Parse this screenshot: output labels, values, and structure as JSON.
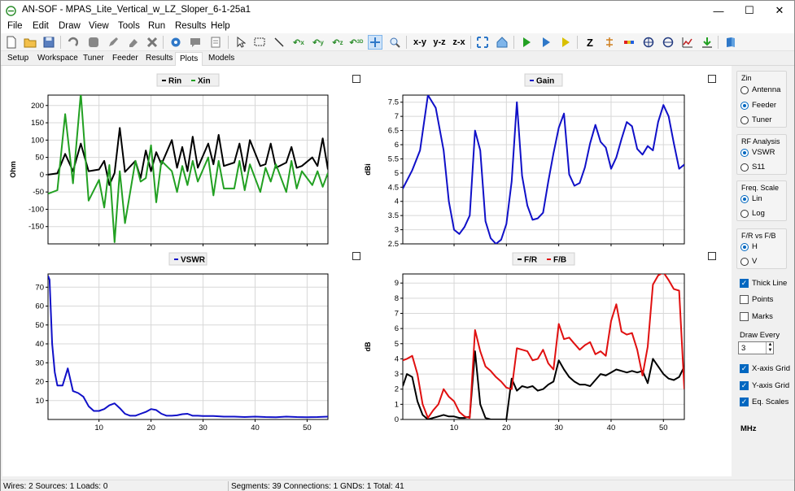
{
  "window": {
    "title": "AN-SOF - MPAS_Lite_Vertical_w_LZ_Sloper_6-1-25a1",
    "minimize": "—",
    "maximize": "☐",
    "close": "✕"
  },
  "menu": [
    "File",
    "Edit",
    "Draw",
    "View",
    "Tools",
    "Run",
    "Results",
    "Help"
  ],
  "toolbar": {
    "projection_labels": [
      "x-y",
      "y-z",
      "z-x"
    ],
    "zin_label": "Z",
    "icons": [
      "new-file-icon",
      "open-folder-icon",
      "save-icon",
      "undo-icon",
      "stop-icon",
      "pencil-icon",
      "eraser-icon",
      "delete-icon",
      "settings-gear-icon",
      "comment-icon",
      "notes-icon",
      "pointer-icon",
      "select-rect-icon",
      "line-icon",
      "rotate-x-icon",
      "rotate-y-icon",
      "rotate-z-icon",
      "rotate-3d-icon",
      "pan-icon",
      "zoom-icon",
      "fit-icon",
      "home-icon",
      "run-icon",
      "run-step-icon",
      "run-all-icon",
      "zin-icon",
      "current-distribution-icon",
      "near-field-icon",
      "far-field-3d-icon",
      "far-field-2d-icon",
      "chart-icon",
      "export-icon",
      "help-book-icon"
    ]
  },
  "tabs": [
    "Setup",
    "Workspace",
    "Tuner",
    "Feeder",
    "Results",
    "Plots",
    "Models"
  ],
  "active_tab": "Plots",
  "colors": {
    "black_series": "#000000",
    "green_series": "#22a022",
    "blue_series": "#1010c8",
    "red_series": "#e01010",
    "accent": "#0067c0"
  },
  "sidebar": {
    "zin": {
      "title": "Zin",
      "options": [
        "Antenna",
        "Feeder",
        "Tuner"
      ],
      "selected": "Feeder"
    },
    "rf": {
      "title": "RF Analysis",
      "options": [
        "VSWR",
        "S11"
      ],
      "selected": "VSWR"
    },
    "freq": {
      "title": "Freq. Scale",
      "options": [
        "Lin",
        "Log"
      ],
      "selected": "Lin"
    },
    "fr": {
      "title": "F/R vs F/B",
      "options": [
        "H",
        "V"
      ],
      "selected": "H"
    },
    "checks": [
      {
        "label": "Thick Line",
        "checked": true
      },
      {
        "label": "Points",
        "checked": false
      },
      {
        "label": "Marks",
        "checked": false
      }
    ],
    "draw_every_label": "Draw Every",
    "draw_every_value": "3",
    "checks2": [
      {
        "label": "X-axis Grid",
        "checked": true
      },
      {
        "label": "Y-axis Grid",
        "checked": true
      },
      {
        "label": "Eq. Scales",
        "checked": true
      }
    ],
    "unit": "MHz"
  },
  "status": {
    "left": "Wires: 2  Sources: 1  Loads: 0",
    "right": "Segments: 39  Connections: 1  GNDs: 1  Total: 41"
  },
  "chart_data": [
    {
      "type": "line",
      "ylabel": "Ohm",
      "xlim": [
        0.2,
        54
      ],
      "ylim": [
        -200,
        230
      ],
      "yticks": [
        -150,
        -100,
        -50,
        0,
        50,
        100,
        150,
        200
      ],
      "xticks": [
        10,
        20,
        30,
        40,
        50
      ],
      "show_x_ticklabels": false,
      "grid": true,
      "legend": "top-center",
      "x": [
        0.2,
        2,
        3.5,
        5,
        6.5,
        8,
        10,
        11,
        12,
        13,
        14,
        15,
        17,
        18,
        19,
        20,
        21,
        22,
        24,
        25,
        26,
        27,
        28,
        29,
        31,
        32,
        33,
        34,
        36,
        37,
        38,
        39,
        41,
        42,
        43,
        44,
        46,
        47,
        48,
        49,
        51,
        52,
        53,
        54
      ],
      "series": [
        {
          "name": "Rin",
          "color": "#000000",
          "values": [
            0,
            4,
            60,
            10,
            90,
            10,
            15,
            40,
            -30,
            5,
            135,
            8,
            40,
            -10,
            70,
            10,
            65,
            30,
            100,
            20,
            80,
            10,
            110,
            20,
            90,
            30,
            115,
            25,
            35,
            90,
            10,
            100,
            25,
            30,
            90,
            20,
            35,
            80,
            20,
            25,
            50,
            25,
            105,
            15
          ]
        },
        {
          "name": "Xin",
          "color": "#22a022",
          "values": [
            -55,
            -45,
            175,
            -25,
            235,
            -75,
            -15,
            -95,
            28,
            -195,
            10,
            -140,
            40,
            -20,
            -10,
            85,
            -80,
            40,
            10,
            -50,
            25,
            -30,
            40,
            -20,
            50,
            -60,
            40,
            -40,
            -40,
            40,
            -45,
            30,
            -50,
            20,
            -20,
            30,
            -50,
            40,
            -40,
            10,
            -30,
            10,
            -35,
            5
          ]
        }
      ]
    },
    {
      "type": "line",
      "ylabel": "dBi",
      "xlim": [
        0.2,
        54
      ],
      "ylim": [
        2.5,
        7.75
      ],
      "yticks": [
        2.5,
        3,
        3.5,
        4,
        4.5,
        5,
        5.5,
        6,
        6.5,
        7,
        7.5
      ],
      "xticks": [
        10,
        20,
        30,
        40,
        50
      ],
      "show_x_ticklabels": false,
      "grid": true,
      "legend": "top-center",
      "x": [
        0.2,
        2,
        3.5,
        5,
        6.5,
        8,
        9,
        10,
        11,
        12,
        13,
        14,
        15,
        16,
        17,
        18,
        19,
        20,
        21,
        22,
        23,
        24,
        25,
        26,
        27,
        28,
        29,
        30,
        31,
        32,
        33,
        34,
        35,
        36,
        37,
        38,
        39,
        40,
        41,
        42,
        43,
        44,
        45,
        46,
        47,
        48,
        49,
        50,
        51,
        52,
        53,
        54
      ],
      "series": [
        {
          "name": "Gain",
          "color": "#1010c8",
          "values": [
            4.45,
            5.1,
            5.8,
            7.75,
            7.3,
            5.8,
            4,
            3,
            2.85,
            3.1,
            3.5,
            6.5,
            5.8,
            3.3,
            2.7,
            2.5,
            2.65,
            3.2,
            4.7,
            7.5,
            4.9,
            3.85,
            3.35,
            3.4,
            3.6,
            4.7,
            5.7,
            6.6,
            7.1,
            4.95,
            4.55,
            4.65,
            5.2,
            6.05,
            6.7,
            6.1,
            5.9,
            5.15,
            5.55,
            6.2,
            6.8,
            6.65,
            5.85,
            5.65,
            5.95,
            5.8,
            6.8,
            7.4,
            7,
            6.05,
            5.15,
            5.3,
            6.35,
            7
          ]
        }
      ]
    },
    {
      "type": "line",
      "ylabel": "",
      "xlim": [
        0.2,
        54
      ],
      "ylim": [
        0,
        77
      ],
      "yticks": [
        10,
        20,
        30,
        40,
        50,
        60,
        70
      ],
      "xticks": [
        10,
        20,
        30,
        40,
        50
      ],
      "show_x_ticklabels": true,
      "grid": true,
      "legend": "top-center",
      "x": [
        0.2,
        0.5,
        1,
        1.5,
        2,
        3,
        4,
        5,
        6,
        7,
        8,
        9,
        10,
        11,
        12,
        13,
        14,
        15,
        16,
        17,
        18,
        19,
        20,
        21,
        22,
        23,
        24,
        25,
        26,
        27,
        28,
        29,
        30,
        32,
        34,
        36,
        38,
        40,
        42,
        44,
        46,
        48,
        50,
        52,
        54
      ],
      "series": [
        {
          "name": "VSWR",
          "color": "#1010c8",
          "values": [
            76,
            74,
            40,
            25,
            18,
            18,
            27,
            15,
            14,
            12,
            7,
            4.5,
            4.5,
            5.5,
            7.5,
            8.5,
            6,
            3,
            2,
            2,
            3,
            4,
            5.5,
            5,
            3,
            2,
            2,
            2.2,
            2.8,
            3,
            2,
            2,
            1.8,
            1.8,
            1.5,
            1.5,
            1.3,
            1.5,
            1.3,
            1.2,
            1.5,
            1.3,
            1.2,
            1.3,
            1.5
          ]
        }
      ]
    },
    {
      "type": "line",
      "ylabel": "dB",
      "xlim": [
        0.2,
        54
      ],
      "ylim": [
        0,
        9.6
      ],
      "yticks": [
        0,
        1,
        2,
        3,
        4,
        5,
        6,
        7,
        8,
        9
      ],
      "xticks": [
        10,
        20,
        30,
        40,
        50
      ],
      "show_x_ticklabels": true,
      "grid": true,
      "legend": "top-center",
      "x": [
        0.2,
        1,
        2,
        3,
        4,
        5,
        6,
        7,
        8,
        9,
        10,
        11,
        12,
        13,
        14,
        15,
        16,
        17,
        18,
        19,
        20,
        21,
        22,
        23,
        24,
        25,
        26,
        27,
        28,
        29,
        30,
        31,
        32,
        33,
        34,
        35,
        36,
        37,
        38,
        39,
        40,
        41,
        42,
        43,
        44,
        45,
        46,
        47,
        48,
        49,
        50,
        51,
        52,
        53,
        54
      ],
      "series": [
        {
          "name": "F/R",
          "color": "#000000",
          "values": [
            2.2,
            3,
            2.8,
            1.2,
            0.3,
            0,
            0.1,
            0.2,
            0.3,
            0.2,
            0.2,
            0.1,
            0.1,
            0.2,
            4.5,
            1,
            0.1,
            0,
            0,
            0,
            0,
            2.7,
            1.9,
            2.2,
            2.1,
            2.2,
            1.9,
            2,
            2.3,
            2.5,
            3.9,
            3.3,
            2.8,
            2.5,
            2.3,
            2.3,
            2.2,
            2.6,
            3,
            2.9,
            3.1,
            3.3,
            3.2,
            3.1,
            3.2,
            3.1,
            3.2,
            2.4,
            4,
            3.5,
            3,
            2.7,
            2.6,
            2.8,
            3.5,
            2.5,
            0.7,
            1.5,
            3.3
          ]
        },
        {
          "name": "F/B",
          "color": "#e01010",
          "values": [
            3.9,
            4,
            4.2,
            3,
            1,
            0.1,
            0.6,
            1,
            2,
            1.5,
            1.2,
            0.5,
            0.2,
            0.1,
            5.9,
            4.5,
            3.5,
            3.2,
            2.8,
            2.5,
            2.1,
            2,
            4.7,
            4.6,
            4.5,
            3.9,
            4,
            4.6,
            3.7,
            3.3,
            6.3,
            5.3,
            5.4,
            5,
            4.6,
            4.9,
            5.1,
            4.3,
            4.5,
            4.2,
            6.5,
            7.6,
            5.8,
            5.6,
            5.7,
            4.6,
            2.9,
            4.8,
            8.9,
            9.5,
            9.7,
            9.2,
            8.6,
            8.5,
            2,
            5.3,
            7.8
          ]
        }
      ]
    }
  ]
}
